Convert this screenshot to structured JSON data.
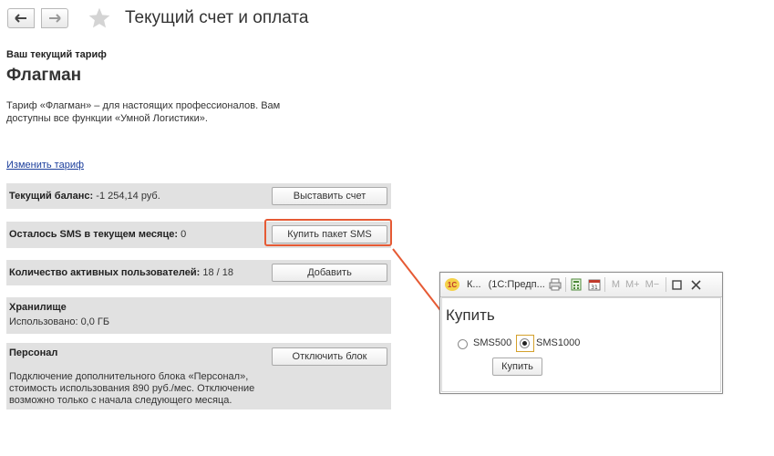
{
  "header": {
    "title": "Текущий счет и оплата"
  },
  "tariff": {
    "caption": "Ваш текущий тариф",
    "name": "Флагман",
    "description": "Тариф «Флагман» – для настоящих профессионалов. Вам доступны все функции «Умной Логистики».",
    "change_link": "Изменить тариф"
  },
  "balance": {
    "label": "Текущий баланс:",
    "value": "-1 254,14 руб.",
    "button": "Выставить счет"
  },
  "sms": {
    "label": "Осталось SMS в текущем месяце:",
    "value": "0",
    "button": "Купить пакет SMS"
  },
  "users": {
    "label": "Количество активных пользователей:",
    "value": "18 / 18",
    "button": "Добавить"
  },
  "storage": {
    "label": "Хранилище",
    "used": "Использовано: 0,0 ГБ"
  },
  "personal": {
    "label": "Персонал",
    "button": "Отключить блок",
    "description": "Подключение дополнительного блока «Персонал», стоимость использования 890 руб./мес. Отключение возможно только с начала следующего месяца."
  },
  "popup": {
    "logo": "1C",
    "tab_short": "К...",
    "app_title": "(1С:Предп...",
    "m_label": "M",
    "mplus_label": "M+",
    "mminus_label": "M−",
    "heading": "Купить",
    "options": [
      {
        "label": "SMS500",
        "selected": false
      },
      {
        "label": "SMS1000",
        "selected": true
      }
    ],
    "buy_button": "Купить"
  },
  "colors": {
    "highlight": "#e65a34",
    "link": "#1c3f9c",
    "panel": "#e1e1e1"
  }
}
